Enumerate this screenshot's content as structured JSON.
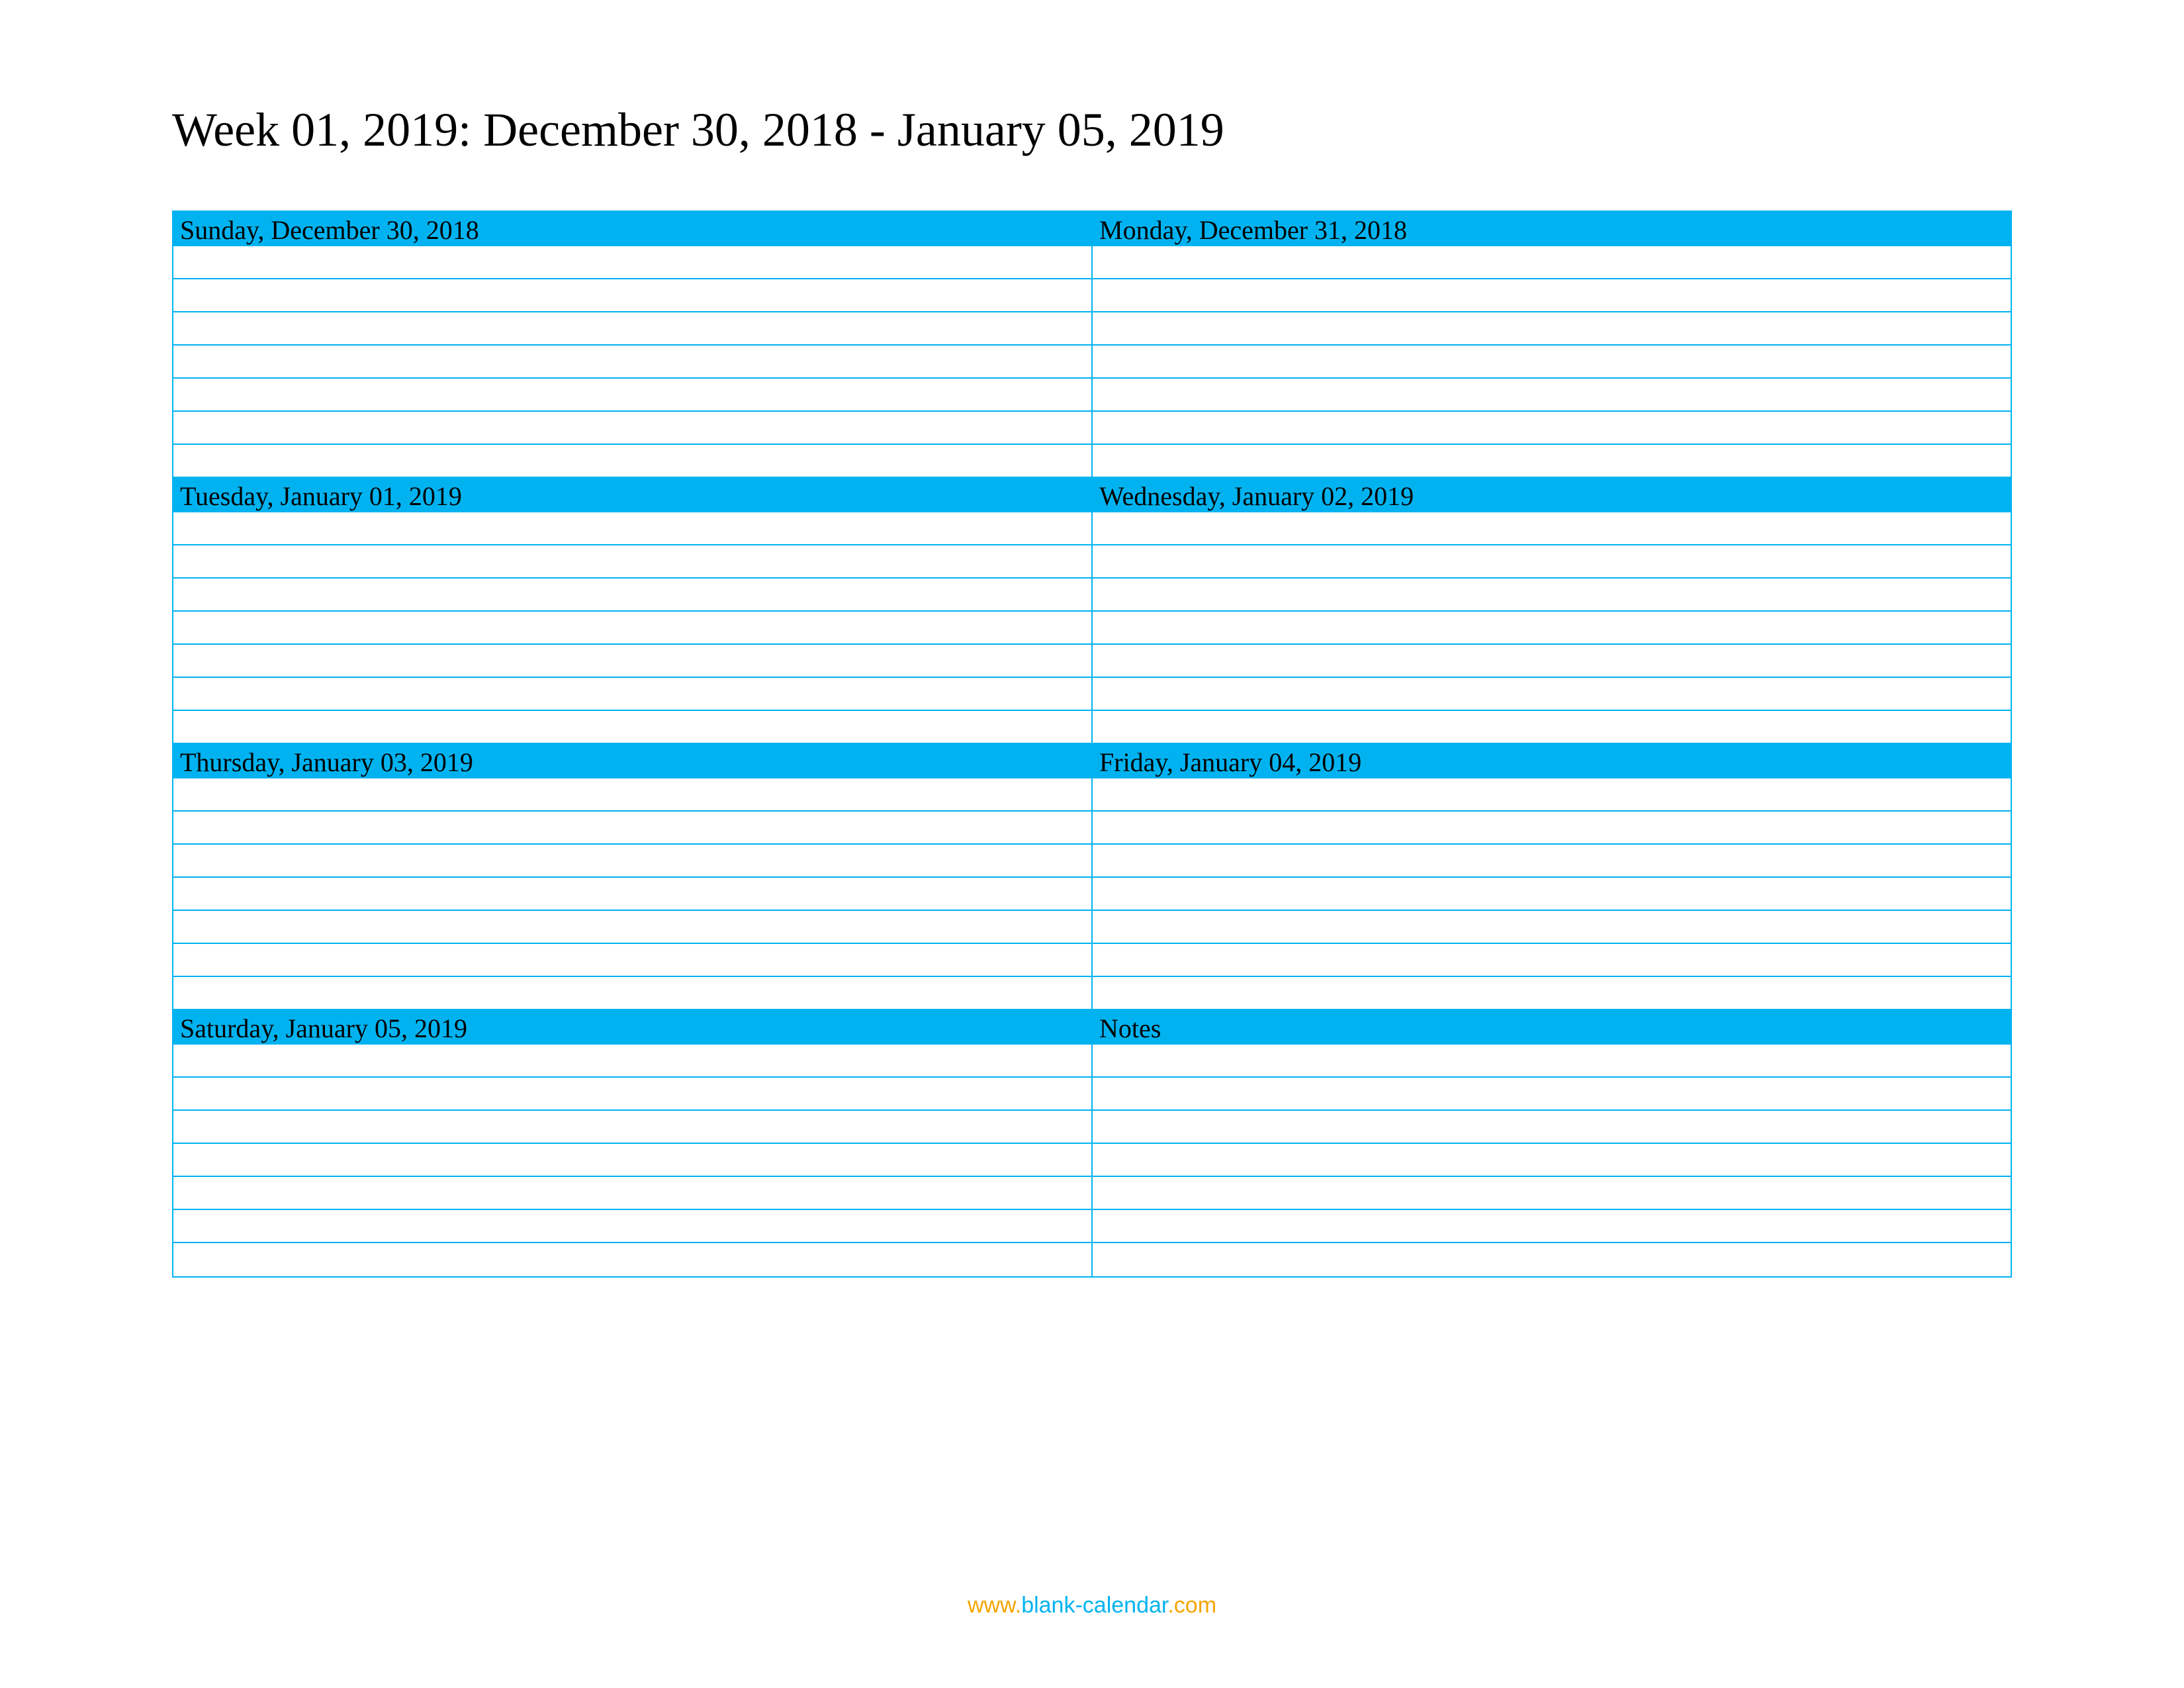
{
  "title": "Week 01, 2019: December 30, 2018 - January 05, 2019",
  "days": [
    "Sunday, December 30, 2018",
    "Monday, December 31, 2018",
    "Tuesday, January 01, 2019",
    "Wednesday, January 02, 2019",
    "Thursday, January 03, 2019",
    "Friday, January 04, 2019",
    "Saturday, January 05, 2019",
    "Notes"
  ],
  "lines_per_day": 7,
  "footer": {
    "www": "www.",
    "domain": "blank-calendar",
    "com": ".com"
  },
  "colors": {
    "accent": "#00b3f0",
    "footer_accent": "#f5a500"
  }
}
